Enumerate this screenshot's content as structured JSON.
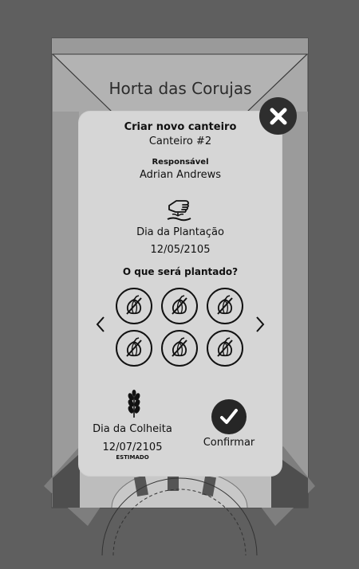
{
  "app": {
    "title": "Horta das Corujas"
  },
  "modal": {
    "title": "Criar novo canteiro",
    "subtitle": "Canteiro #2",
    "responsible_label": "Responsável",
    "responsible_name": "Adrian Andrews",
    "planting_label": "Dia da Plantação",
    "planting_date": "12/05/2105",
    "question": "O que será plantado?",
    "seeds": [
      {
        "icon": "onion-icon"
      },
      {
        "icon": "onion-icon"
      },
      {
        "icon": "onion-icon"
      },
      {
        "icon": "onion-icon"
      },
      {
        "icon": "onion-icon"
      },
      {
        "icon": "onion-icon"
      }
    ],
    "harvest_label": "Dia da Colheita",
    "harvest_date": "12/07/2105",
    "harvest_note": "ESTIMADO",
    "confirm_label": "Confirmar"
  },
  "colors": {
    "background": "#5f5f5f",
    "modal": "#d6d6d6",
    "dark": "#2e2e2e"
  }
}
